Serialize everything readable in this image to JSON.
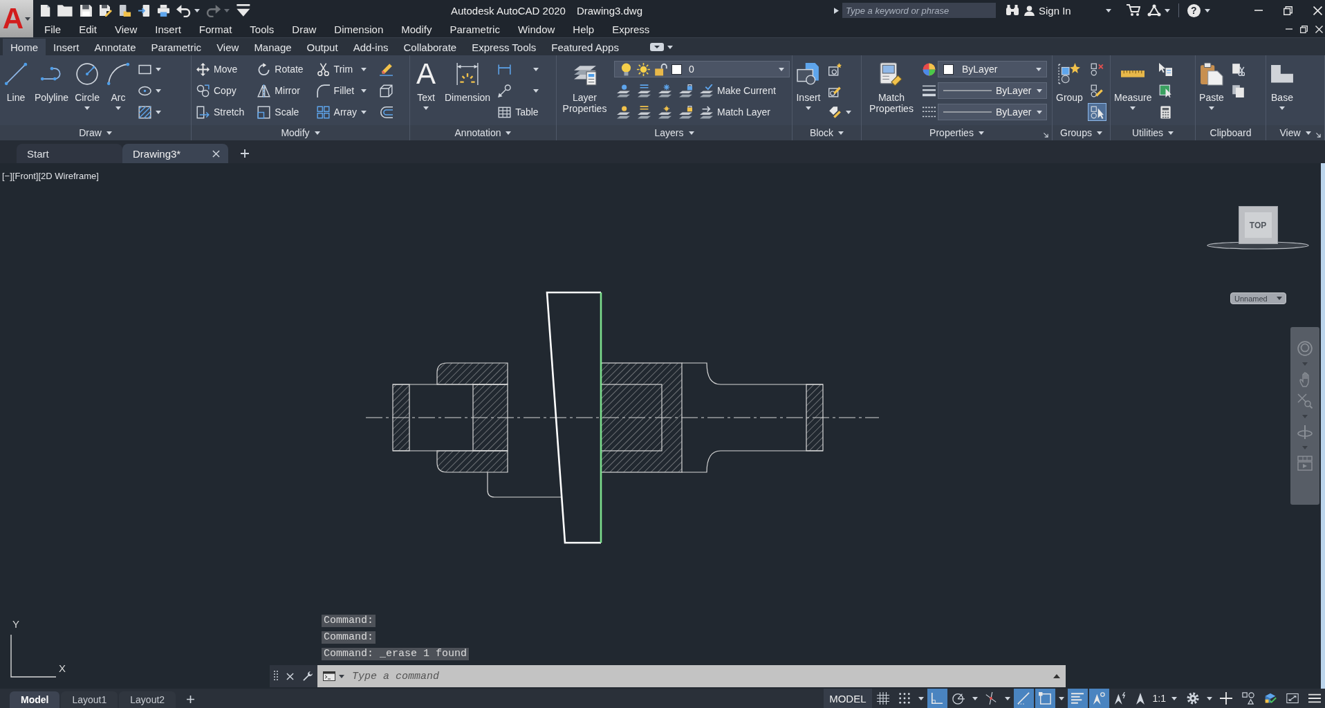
{
  "title_bar": {
    "app_letter": "A",
    "quick_access": [
      {
        "kind": "new",
        "menu": false,
        "disabled": false
      },
      {
        "kind": "open",
        "menu": false,
        "disabled": false
      },
      {
        "kind": "save",
        "menu": false,
        "disabled": false
      },
      {
        "kind": "save_as",
        "menu": false,
        "disabled": false
      },
      {
        "kind": "open_web",
        "menu": false,
        "disabled": false
      },
      {
        "kind": "share",
        "menu": false,
        "disabled": false
      },
      {
        "kind": "plot",
        "menu": false,
        "disabled": false
      },
      {
        "kind": "undo",
        "menu": true,
        "disabled": false
      },
      {
        "kind": "redo",
        "menu": true,
        "disabled": true
      },
      {
        "kind": "customize",
        "menu": false,
        "disabled": false
      }
    ],
    "title": "Autodesk AutoCAD 2020",
    "file_name": "Drawing3.dwg",
    "search": {
      "placeholder": "Type a keyword or phrase"
    },
    "sign_in": "Sign In",
    "help": "?"
  },
  "menu_bar": [
    "File",
    "Edit",
    "View",
    "Insert",
    "Format",
    "Tools",
    "Draw",
    "Dimension",
    "Modify",
    "Parametric",
    "Window",
    "Help",
    "Express"
  ],
  "ribbon_tabs": [
    {
      "label": "Home",
      "selected": true
    },
    {
      "label": "Insert",
      "selected": false
    },
    {
      "label": "Annotate",
      "selected": false
    },
    {
      "label": "Parametric",
      "selected": false
    },
    {
      "label": "View",
      "selected": false
    },
    {
      "label": "Manage",
      "selected": false
    },
    {
      "label": "Output",
      "selected": false
    },
    {
      "label": "Add-ins",
      "selected": false
    },
    {
      "label": "Collaborate",
      "selected": false
    },
    {
      "label": "Express Tools",
      "selected": false
    },
    {
      "label": "Featured Apps",
      "selected": false
    }
  ],
  "ribbon_panels": [
    {
      "title": "Draw",
      "menu": true,
      "launcher": false,
      "groups": [
        {
          "kind": "large",
          "label": "Line",
          "menu": false
        },
        {
          "kind": "large",
          "label": "Polyline",
          "menu": false
        },
        {
          "kind": "large",
          "label": "Circle",
          "menu": true
        },
        {
          "kind": "large",
          "label": "Arc",
          "menu": true
        },
        {
          "kind": "stack",
          "rows": [
            [
              {
                "kind": "tool",
                "menu": true
              }
            ],
            [
              {
                "kind": "tool",
                "menu": true
              }
            ],
            [
              {
                "kind": "tool",
                "menu": true
              }
            ]
          ]
        }
      ]
    },
    {
      "title": "Modify",
      "menu": true,
      "launcher": false,
      "groups": [
        {
          "kind": "stack",
          "rows": [
            [
              {
                "kind": "tool",
                "label": "Move",
                "menu": false
              }
            ],
            [
              {
                "kind": "tool",
                "label": "Copy",
                "menu": false
              }
            ],
            [
              {
                "kind": "tool",
                "label": "Stretch",
                "menu": false
              }
            ]
          ]
        },
        {
          "kind": "stack",
          "rows": [
            [
              {
                "kind": "tool",
                "label": "Rotate",
                "menu": false
              }
            ],
            [
              {
                "kind": "tool",
                "label": "Mirror",
                "menu": false
              }
            ],
            [
              {
                "kind": "tool",
                "label": "Scale",
                "menu": false
              }
            ]
          ]
        },
        {
          "kind": "stack",
          "rows": [
            [
              {
                "kind": "tool",
                "label": "Trim",
                "menu": true
              }
            ],
            [
              {
                "kind": "tool",
                "label": "Fillet",
                "menu": true
              }
            ],
            [
              {
                "kind": "tool",
                "label": "Array",
                "menu": true
              }
            ]
          ]
        },
        {
          "kind": "stack",
          "rows": [
            [
              {
                "kind": "tool",
                "menu": false
              }
            ],
            [
              {
                "kind": "tool",
                "menu": false
              }
            ],
            [
              {
                "kind": "tool",
                "menu": false
              }
            ]
          ]
        }
      ]
    },
    {
      "title": "Annotation",
      "menu": true,
      "launcher": false,
      "groups": [
        {
          "kind": "large",
          "label": "Text",
          "glyph": "A",
          "menu": true
        },
        {
          "kind": "large",
          "label": "Dimension",
          "menu": false
        },
        {
          "kind": "stack",
          "rows": [
            [
              {
                "kind": "tool",
                "menu": true
              }
            ],
            [
              {
                "kind": "tool",
                "menu": true
              }
            ],
            [
              {
                "kind": "tool",
                "label": "Table",
                "menu": false
              }
            ]
          ]
        }
      ]
    },
    {
      "title": "Layers",
      "menu": true,
      "launcher": false,
      "groups": [
        {
          "kind": "large",
          "label": "Layer Properties",
          "menu": false
        },
        {
          "kind": "stack",
          "rows": [
            [
              {
                "kind": "layer_select",
                "value": "0"
              }
            ],
            [
              {
                "kind": "tool",
                "menu": false
              },
              {
                "kind": "tool",
                "menu": false
              },
              {
                "kind": "tool",
                "menu": false
              },
              {
                "kind": "tool",
                "menu": false
              },
              {
                "kind": "tool",
                "label": "Make Current",
                "menu": false
              }
            ],
            [
              {
                "kind": "tool",
                "menu": false
              },
              {
                "kind": "tool",
                "menu": false
              },
              {
                "kind": "tool",
                "menu": false
              },
              {
                "kind": "tool",
                "menu": false
              },
              {
                "kind": "tool",
                "label": "Match Layer",
                "menu": false
              }
            ]
          ]
        }
      ]
    },
    {
      "title": "Block",
      "menu": true,
      "launcher": false,
      "groups": [
        {
          "kind": "large",
          "label": "Insert",
          "menu": true
        },
        {
          "kind": "stack",
          "rows": [
            [
              {
                "kind": "tool",
                "menu": false
              }
            ],
            [
              {
                "kind": "tool",
                "menu": false
              }
            ],
            [
              {
                "kind": "tool",
                "menu": true
              }
            ]
          ]
        }
      ]
    },
    {
      "title": "Properties",
      "menu": true,
      "launcher": true,
      "groups": [
        {
          "kind": "large",
          "label": "Match Properties",
          "menu": false
        },
        {
          "kind": "stack",
          "rows": [
            [
              {
                "kind": "color_select",
                "value": "ByLayer"
              }
            ],
            [
              {
                "kind": "line_select",
                "value": "ByLayer"
              }
            ],
            [
              {
                "kind": "line_select",
                "value": "ByLayer"
              }
            ]
          ]
        }
      ]
    },
    {
      "title": "Groups",
      "menu": true,
      "launcher": false,
      "groups": [
        {
          "kind": "large",
          "label": "Group",
          "menu": false
        },
        {
          "kind": "stack",
          "rows": [
            [
              {
                "kind": "tool",
                "menu": false,
                "on": false
              }
            ],
            [
              {
                "kind": "tool",
                "menu": false,
                "on": false
              }
            ],
            [
              {
                "kind": "tool",
                "menu": false,
                "on": true
              }
            ]
          ]
        }
      ]
    },
    {
      "title": "Utilities",
      "menu": true,
      "launcher": false,
      "groups": [
        {
          "kind": "large",
          "label": "Measure",
          "menu": true
        },
        {
          "kind": "stack",
          "rows": [
            [
              {
                "kind": "tool",
                "menu": false
              }
            ],
            [
              {
                "kind": "tool",
                "menu": false
              }
            ],
            [
              {
                "kind": "tool",
                "menu": false
              }
            ]
          ]
        }
      ]
    },
    {
      "title": "Clipboard",
      "menu": false,
      "launcher": false,
      "groups": [
        {
          "kind": "large",
          "label": "Paste",
          "menu": true
        },
        {
          "kind": "stack",
          "rows": [
            [
              {
                "kind": "tool",
                "menu": false
              }
            ],
            [
              {
                "kind": "tool",
                "menu": false
              }
            ]
          ]
        }
      ]
    },
    {
      "title": "View",
      "menu": true,
      "launcher": true,
      "groups": [
        {
          "kind": "large",
          "label": "Base",
          "menu": true
        }
      ]
    }
  ],
  "document_tabs": [
    {
      "label": "Start",
      "selected": false,
      "closable": false
    },
    {
      "label": "Drawing3*",
      "selected": true,
      "closable": true
    }
  ],
  "viewport": {
    "controls": [
      "[−]",
      "[Front]",
      "[2D Wireframe]"
    ],
    "viewcube_face": "TOP",
    "named_view": "Unnamed",
    "ucs_y": "Y",
    "ucs_x": "X"
  },
  "command_line": {
    "history": [
      "Command:",
      "Command:",
      "Command: _erase 1 found"
    ],
    "placeholder": "Type a command"
  },
  "layout_tabs": [
    {
      "label": "Model",
      "selected": true
    },
    {
      "label": "Layout1",
      "selected": false
    },
    {
      "label": "Layout2",
      "selected": false
    }
  ],
  "status_bar": {
    "space": "MODEL",
    "toggles": [
      {
        "kind": "grid",
        "on": false,
        "menu": false
      },
      {
        "kind": "snap",
        "on": false,
        "menu": true
      },
      {
        "kind": "ortho",
        "on": true,
        "menu": false
      },
      {
        "kind": "polar",
        "on": false,
        "menu": true
      },
      {
        "kind": "isodraft",
        "on": false,
        "menu": true
      },
      {
        "kind": "tracking",
        "on": true,
        "menu": false
      },
      {
        "kind": "osnap",
        "on": true,
        "menu": true
      },
      {
        "kind": "lineweight",
        "on": true,
        "menu": false
      },
      {
        "kind": "annotation_visibility",
        "on": true,
        "menu": false
      },
      {
        "kind": "autoscale",
        "on": false,
        "menu": false
      }
    ],
    "scale": "1:1",
    "tools": [
      {
        "kind": "workspace",
        "menu": true
      },
      {
        "kind": "annotation_monitor",
        "menu": false
      },
      {
        "kind": "isolate",
        "menu": false
      },
      {
        "kind": "hardware",
        "menu": false
      },
      {
        "kind": "clean_screen",
        "menu": false
      },
      {
        "kind": "customize",
        "menu": false
      }
    ]
  }
}
